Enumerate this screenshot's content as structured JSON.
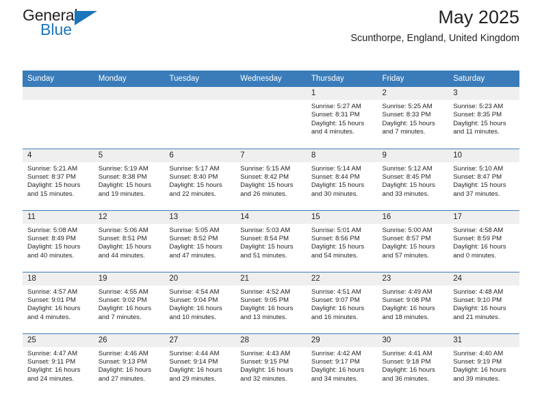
{
  "brand": {
    "name_part1": "General",
    "name_part2": "Blue",
    "triangle_color": "#1b75bb"
  },
  "header": {
    "title": "May 2025",
    "subtitle": "Scunthorpe, England, United Kingdom",
    "accent_color": "#3a7cb9"
  },
  "weekdays": [
    "Sunday",
    "Monday",
    "Tuesday",
    "Wednesday",
    "Thursday",
    "Friday",
    "Saturday"
  ],
  "labels": {
    "sunrise_prefix": "Sunrise:",
    "sunset_prefix": "Sunset:",
    "daylight_prefix": "Daylight:"
  },
  "weeks": [
    [
      {
        "day": "",
        "empty": true
      },
      {
        "day": "",
        "empty": true
      },
      {
        "day": "",
        "empty": true
      },
      {
        "day": "",
        "empty": true
      },
      {
        "day": "1",
        "sunrise": "Sunrise: 5:27 AM",
        "sunset": "Sunset: 8:31 PM",
        "daylight": "Daylight: 15 hours and 4 minutes."
      },
      {
        "day": "2",
        "sunrise": "Sunrise: 5:25 AM",
        "sunset": "Sunset: 8:33 PM",
        "daylight": "Daylight: 15 hours and 7 minutes."
      },
      {
        "day": "3",
        "sunrise": "Sunrise: 5:23 AM",
        "sunset": "Sunset: 8:35 PM",
        "daylight": "Daylight: 15 hours and 11 minutes."
      }
    ],
    [
      {
        "day": "4",
        "sunrise": "Sunrise: 5:21 AM",
        "sunset": "Sunset: 8:37 PM",
        "daylight": "Daylight: 15 hours and 15 minutes."
      },
      {
        "day": "5",
        "sunrise": "Sunrise: 5:19 AM",
        "sunset": "Sunset: 8:38 PM",
        "daylight": "Daylight: 15 hours and 19 minutes."
      },
      {
        "day": "6",
        "sunrise": "Sunrise: 5:17 AM",
        "sunset": "Sunset: 8:40 PM",
        "daylight": "Daylight: 15 hours and 22 minutes."
      },
      {
        "day": "7",
        "sunrise": "Sunrise: 5:15 AM",
        "sunset": "Sunset: 8:42 PM",
        "daylight": "Daylight: 15 hours and 26 minutes."
      },
      {
        "day": "8",
        "sunrise": "Sunrise: 5:14 AM",
        "sunset": "Sunset: 8:44 PM",
        "daylight": "Daylight: 15 hours and 30 minutes."
      },
      {
        "day": "9",
        "sunrise": "Sunrise: 5:12 AM",
        "sunset": "Sunset: 8:45 PM",
        "daylight": "Daylight: 15 hours and 33 minutes."
      },
      {
        "day": "10",
        "sunrise": "Sunrise: 5:10 AM",
        "sunset": "Sunset: 8:47 PM",
        "daylight": "Daylight: 15 hours and 37 minutes."
      }
    ],
    [
      {
        "day": "11",
        "sunrise": "Sunrise: 5:08 AM",
        "sunset": "Sunset: 8:49 PM",
        "daylight": "Daylight: 15 hours and 40 minutes."
      },
      {
        "day": "12",
        "sunrise": "Sunrise: 5:06 AM",
        "sunset": "Sunset: 8:51 PM",
        "daylight": "Daylight: 15 hours and 44 minutes."
      },
      {
        "day": "13",
        "sunrise": "Sunrise: 5:05 AM",
        "sunset": "Sunset: 8:52 PM",
        "daylight": "Daylight: 15 hours and 47 minutes."
      },
      {
        "day": "14",
        "sunrise": "Sunrise: 5:03 AM",
        "sunset": "Sunset: 8:54 PM",
        "daylight": "Daylight: 15 hours and 51 minutes."
      },
      {
        "day": "15",
        "sunrise": "Sunrise: 5:01 AM",
        "sunset": "Sunset: 8:56 PM",
        "daylight": "Daylight: 15 hours and 54 minutes."
      },
      {
        "day": "16",
        "sunrise": "Sunrise: 5:00 AM",
        "sunset": "Sunset: 8:57 PM",
        "daylight": "Daylight: 15 hours and 57 minutes."
      },
      {
        "day": "17",
        "sunrise": "Sunrise: 4:58 AM",
        "sunset": "Sunset: 8:59 PM",
        "daylight": "Daylight: 16 hours and 0 minutes."
      }
    ],
    [
      {
        "day": "18",
        "sunrise": "Sunrise: 4:57 AM",
        "sunset": "Sunset: 9:01 PM",
        "daylight": "Daylight: 16 hours and 4 minutes."
      },
      {
        "day": "19",
        "sunrise": "Sunrise: 4:55 AM",
        "sunset": "Sunset: 9:02 PM",
        "daylight": "Daylight: 16 hours and 7 minutes."
      },
      {
        "day": "20",
        "sunrise": "Sunrise: 4:54 AM",
        "sunset": "Sunset: 9:04 PM",
        "daylight": "Daylight: 16 hours and 10 minutes."
      },
      {
        "day": "21",
        "sunrise": "Sunrise: 4:52 AM",
        "sunset": "Sunset: 9:05 PM",
        "daylight": "Daylight: 16 hours and 13 minutes."
      },
      {
        "day": "22",
        "sunrise": "Sunrise: 4:51 AM",
        "sunset": "Sunset: 9:07 PM",
        "daylight": "Daylight: 16 hours and 16 minutes."
      },
      {
        "day": "23",
        "sunrise": "Sunrise: 4:49 AM",
        "sunset": "Sunset: 9:08 PM",
        "daylight": "Daylight: 16 hours and 18 minutes."
      },
      {
        "day": "24",
        "sunrise": "Sunrise: 4:48 AM",
        "sunset": "Sunset: 9:10 PM",
        "daylight": "Daylight: 16 hours and 21 minutes."
      }
    ],
    [
      {
        "day": "25",
        "sunrise": "Sunrise: 4:47 AM",
        "sunset": "Sunset: 9:11 PM",
        "daylight": "Daylight: 16 hours and 24 minutes."
      },
      {
        "day": "26",
        "sunrise": "Sunrise: 4:46 AM",
        "sunset": "Sunset: 9:13 PM",
        "daylight": "Daylight: 16 hours and 27 minutes."
      },
      {
        "day": "27",
        "sunrise": "Sunrise: 4:44 AM",
        "sunset": "Sunset: 9:14 PM",
        "daylight": "Daylight: 16 hours and 29 minutes."
      },
      {
        "day": "28",
        "sunrise": "Sunrise: 4:43 AM",
        "sunset": "Sunset: 9:15 PM",
        "daylight": "Daylight: 16 hours and 32 minutes."
      },
      {
        "day": "29",
        "sunrise": "Sunrise: 4:42 AM",
        "sunset": "Sunset: 9:17 PM",
        "daylight": "Daylight: 16 hours and 34 minutes."
      },
      {
        "day": "30",
        "sunrise": "Sunrise: 4:41 AM",
        "sunset": "Sunset: 9:18 PM",
        "daylight": "Daylight: 16 hours and 36 minutes."
      },
      {
        "day": "31",
        "sunrise": "Sunrise: 4:40 AM",
        "sunset": "Sunset: 9:19 PM",
        "daylight": "Daylight: 16 hours and 39 minutes."
      }
    ]
  ]
}
